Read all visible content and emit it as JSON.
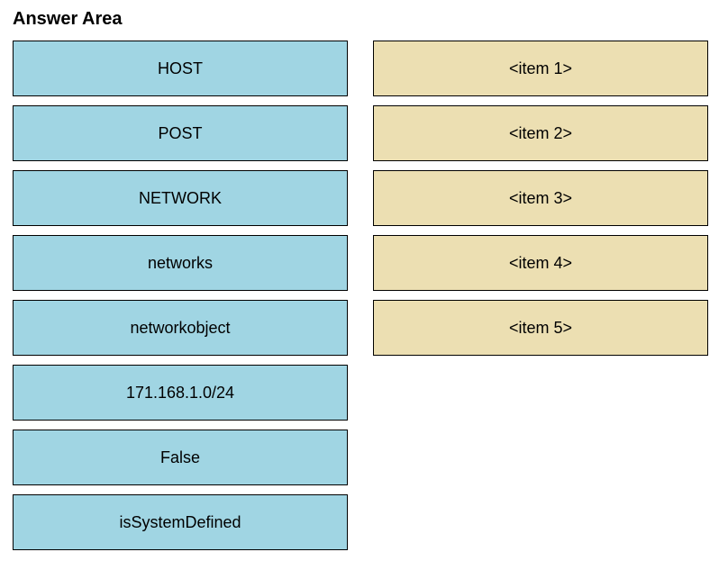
{
  "title": "Answer Area",
  "left_items": [
    "HOST",
    "POST",
    "NETWORK",
    "networks",
    "networkobject",
    "171.168.1.0/24",
    "False",
    "isSystemDefined"
  ],
  "right_items": [
    "<item 1>",
    "<item 2>",
    "<item 3>",
    "<item 4>",
    "<item 5>"
  ]
}
